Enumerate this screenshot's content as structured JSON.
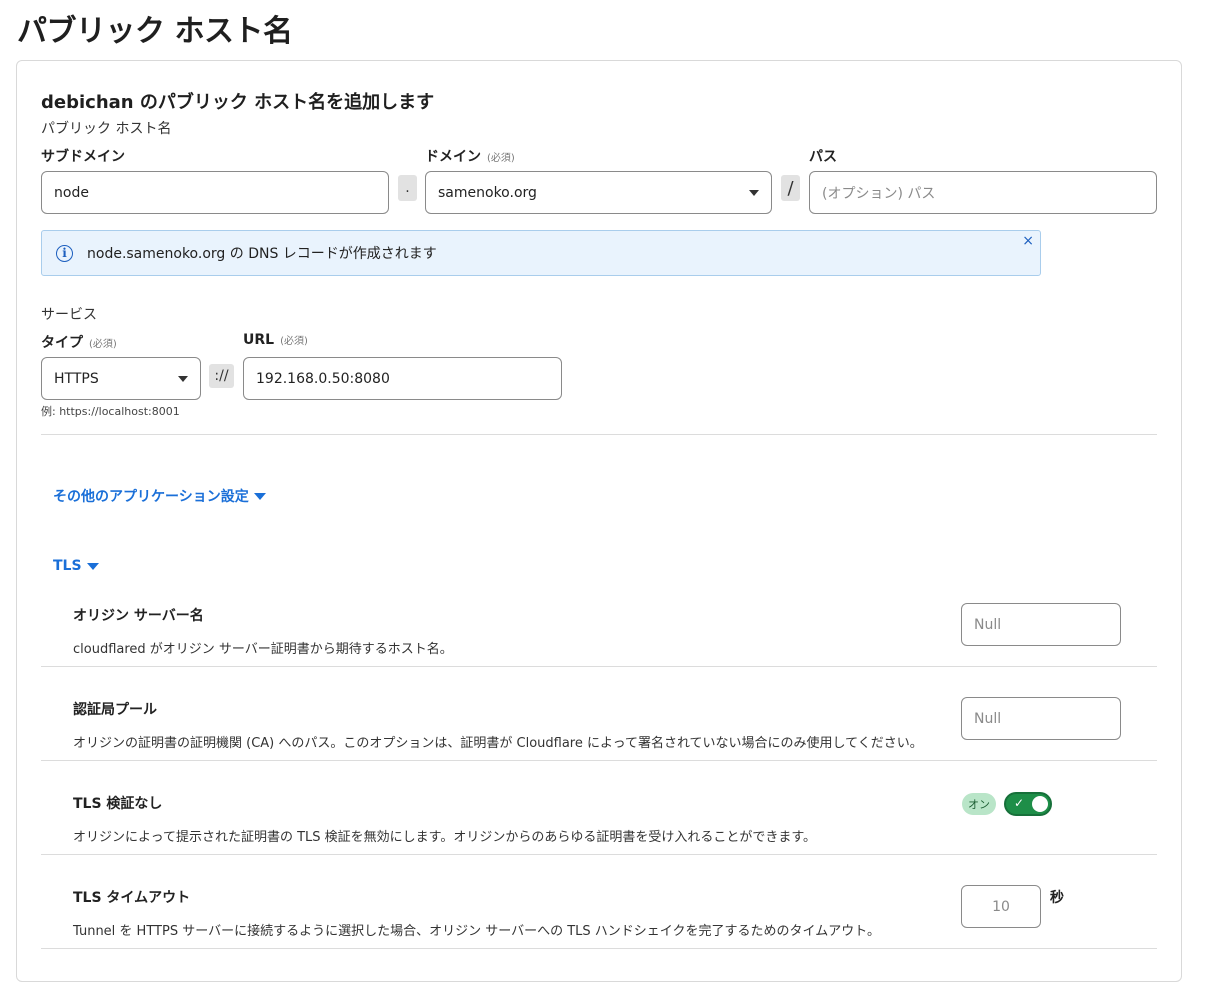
{
  "page": {
    "title": "パブリック ホスト名"
  },
  "card": {
    "title": "debichan のパブリック ホスト名を追加します",
    "hostname_section": "パブリック ホスト名",
    "subdomain": {
      "label": "サブドメイン",
      "value": "node"
    },
    "dot": ".",
    "domain": {
      "label": "ドメイン",
      "required": "(必須)",
      "value": "samenoko.org"
    },
    "slash": "/",
    "path": {
      "label": "パス",
      "placeholder": "(オプション) パス"
    },
    "info": {
      "text": "node.samenoko.org の DNS レコードが作成されます",
      "close": "×",
      "icon": "info-icon"
    },
    "service_section": "サービス",
    "type": {
      "label": "タイプ",
      "required": "(必須)",
      "value": "HTTPS"
    },
    "scheme_sep": "://",
    "url": {
      "label": "URL",
      "required": "(必須)",
      "value": "192.168.0.50:8080"
    },
    "example": "例: https://localhost:8001",
    "app_settings_link": "その他のアプリケーション設定",
    "tls_link": "TLS",
    "tls_rows": [
      {
        "title": "オリジン サーバー名",
        "desc": "cloudflared がオリジン サーバー証明書から期待するホスト名。",
        "placeholder": "Null"
      },
      {
        "title": "認証局プール",
        "desc": "オリジンの証明書の証明機関 (CA) へのパス。このオプションは、証明書が Cloudflare によって署名されていない場合にのみ使用してください。",
        "placeholder": "Null"
      },
      {
        "title": "TLS 検証なし",
        "desc": "オリジンによって提示された証明書の TLS 検証を無効にします。オリジンからのあらゆる証明書を受け入れることができます。",
        "badge": "オン",
        "toggle_on": true
      },
      {
        "title": "TLS タイムアウト",
        "desc": "Tunnel を HTTPS サーバーに接続するように選択した場合、オリジン サーバーへの TLS ハンドシェイクを完了するためのタイムアウト。",
        "value": "10",
        "unit": "秒"
      }
    ],
    "colors": {
      "link": "#1a6fd8",
      "toggle_on": "#1e8e48",
      "info_bg": "#e9f3fd"
    }
  }
}
